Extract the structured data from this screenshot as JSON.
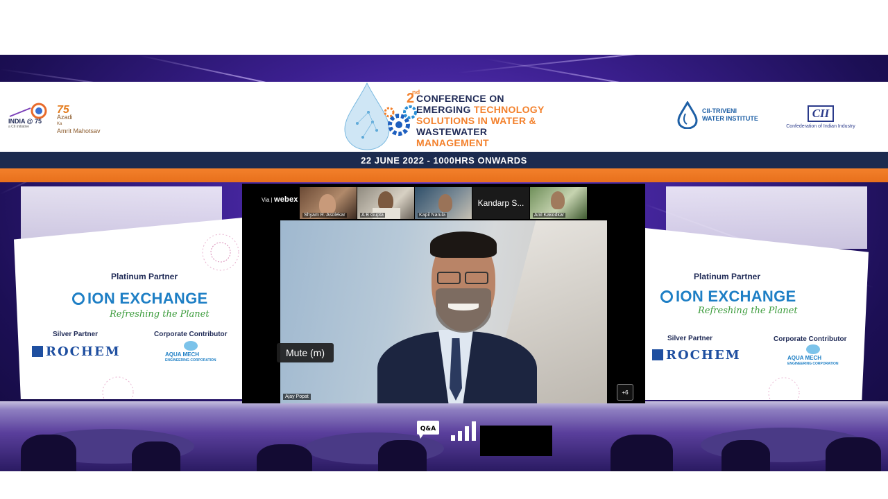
{
  "banner": {
    "india75_text": "INDIA @ 75",
    "india75_sub": "a CII initiative",
    "azadi_num": "75",
    "azadi_line1": "Azadi",
    "azadi_line2": "Ka",
    "azadi_line3": "Amrit Mahotsav",
    "conf_num": "2",
    "conf_sup": "nd",
    "conf_line1": "CONFERENCE ON",
    "conf_line2a": "EMERGING ",
    "conf_line2b": "TECHNOLOGY",
    "conf_line3": "SOLUTIONS IN WATER &",
    "conf_line4": "WASTEWATER",
    "conf_line5": "MANAGEMENT",
    "triveni_line1": "CII-TRIVENI",
    "triveni_line2": "WATER INSTITUTE",
    "cii_logo": "CII",
    "cii_sub": "Confederation of Indian Industry",
    "date_line": "22 JUNE 2022 -  1000HRS ONWARDS"
  },
  "sponsors": {
    "platinum_title": "Platinum Partner",
    "platinum_name": "ION EXCHANGE",
    "platinum_tagline": "Refreshing the Planet",
    "silver_title": "Silver Partner",
    "silver_name": "ROCHEM",
    "corporate_title": "Corporate Contributor",
    "corporate_name_a": "AQUA",
    "corporate_name_b": "MECH",
    "corporate_sub": "ENGINEERING CORPORATION"
  },
  "meeting": {
    "via_label": "Via",
    "app_name": "webex",
    "participants": [
      {
        "name": "Shyam R. Asolekar"
      },
      {
        "name": "A B Gupta"
      },
      {
        "name": "Kapil Narula"
      },
      {
        "name": "Kandarp S..."
      },
      {
        "name": "Anil Kakodkar"
      }
    ],
    "tooltip": "Mute (m)",
    "active_speaker": "Ajay Popat",
    "more_count": "+6"
  },
  "controls": {
    "qa_label": "Q&A"
  },
  "colors": {
    "navy": "#1f2a56",
    "orange": "#f3802b",
    "ion_blue": "#1e7fc5",
    "stage_purple": "#3b1f8f"
  }
}
